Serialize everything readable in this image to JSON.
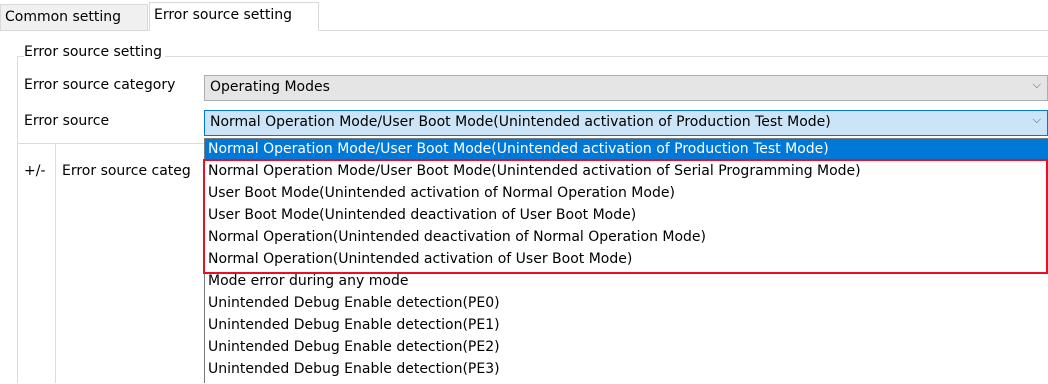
{
  "tabs": {
    "common_label": "Common setting",
    "error_label": "Error source setting"
  },
  "group": {
    "title": "Error source setting"
  },
  "category": {
    "label": "Error source category",
    "value": "Operating Modes"
  },
  "source": {
    "label": "Error source",
    "value": "Normal Operation Mode/User Boot Mode(Unintended activation of Production Test Mode)"
  },
  "grid": {
    "pm_header": "+/-",
    "category_header": "Error source categ"
  },
  "dropdown": {
    "options": [
      "Normal Operation Mode/User Boot Mode(Unintended activation of Production Test Mode)",
      "Normal Operation Mode/User Boot Mode(Unintended activation of Serial Programming Mode)",
      "User Boot Mode(Unintended activation of Normal Operation Mode)",
      "User Boot Mode(Unintended deactivation of User Boot Mode)",
      "Normal Operation(Unintended deactivation of Normal Operation Mode)",
      "Normal Operation(Unintended activation of User Boot Mode)",
      "Mode error during any mode",
      "Unintended Debug Enable detection(PE0)",
      "Unintended Debug Enable detection(PE1)",
      "Unintended Debug Enable detection(PE2)",
      "Unintended Debug Enable detection(PE3)"
    ],
    "selected_index": 0
  },
  "colors": {
    "selection": "#0078d7",
    "highlight_box": "#e81123",
    "combo_focus": "#cce4f7"
  },
  "icons": {
    "combo_arrow": "chevron-down-icon"
  }
}
